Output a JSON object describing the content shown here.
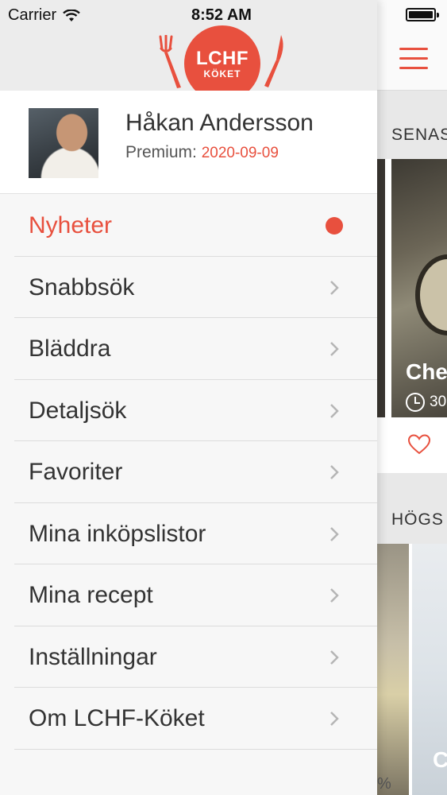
{
  "status": {
    "carrier": "Carrier",
    "time": "8:52 AM"
  },
  "logo": {
    "line1": "LCHF",
    "line2": "KÖKET"
  },
  "profile": {
    "name": "Håkan Andersson",
    "premium_label": "Premium:",
    "premium_date": "2020-09-09"
  },
  "menu": {
    "items": [
      {
        "label": "Nyheter",
        "state": "active",
        "indicator": "dot"
      },
      {
        "label": "Snabbsök",
        "indicator": "chevron"
      },
      {
        "label": "Bläddra",
        "indicator": "chevron"
      },
      {
        "label": "Detaljsök",
        "indicator": "chevron"
      },
      {
        "label": "Favoriter",
        "indicator": "chevron"
      },
      {
        "label": "Mina inköpslistor",
        "indicator": "chevron"
      },
      {
        "label": "Mina recept",
        "indicator": "chevron"
      },
      {
        "label": "Inställningar",
        "indicator": "chevron"
      },
      {
        "label": "Om LCHF-Köket",
        "indicator": "chevron"
      }
    ]
  },
  "main": {
    "section1_title": "SENAS",
    "card1_title": "Che",
    "card1_time": "30",
    "section2_title": "HÖGS",
    "card2_title": "C",
    "partial_text": "%"
  },
  "colors": {
    "accent": "#e8503e",
    "text": "#333333",
    "background": "#f7f7f7"
  }
}
